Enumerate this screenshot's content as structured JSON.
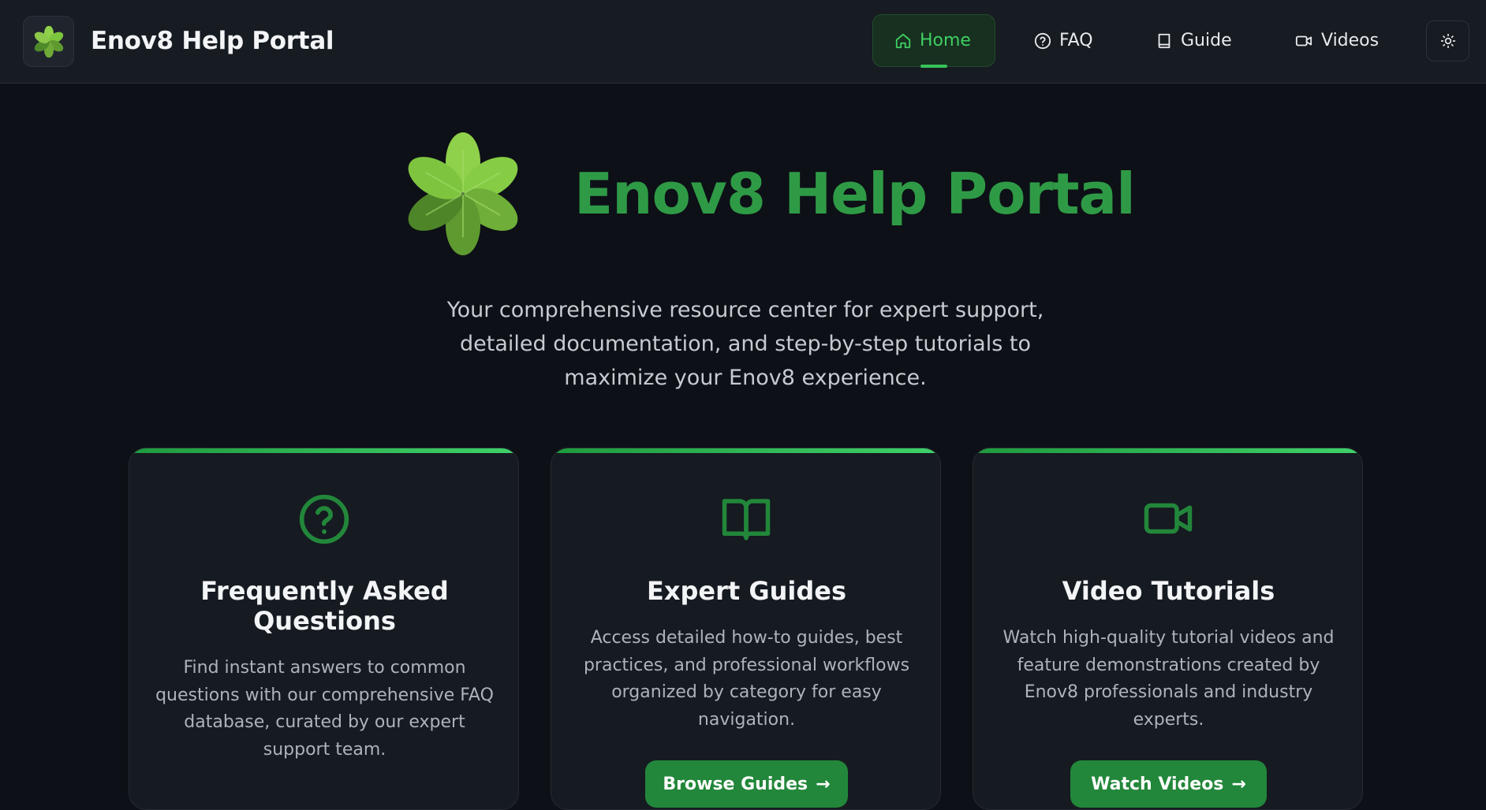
{
  "colors": {
    "accent": "#2f9a46",
    "accent_bright": "#3ecf63",
    "background": "#0d1016",
    "header_bg": "#171b22",
    "card_bg": "#161a21"
  },
  "header": {
    "brand": "Enov8 Help Portal",
    "logo_icon": "clover-icon",
    "nav": [
      {
        "label": "Home",
        "icon": "home-icon",
        "active": true
      },
      {
        "label": "FAQ",
        "icon": "question-circle-icon",
        "active": false
      },
      {
        "label": "Guide",
        "icon": "book-icon",
        "active": false
      },
      {
        "label": "Videos",
        "icon": "video-camera-icon",
        "active": false
      }
    ],
    "theme_toggle_icon": "sun-icon"
  },
  "hero": {
    "title": "Enov8 Help Portal",
    "subtitle": "Your comprehensive resource center for expert support, detailed documentation, and step-by-step tutorials to maximize your Enov8 experience."
  },
  "cards": [
    {
      "icon": "question-circle-icon",
      "title": "Frequently Asked Questions",
      "description": "Find instant answers to common questions with our comprehensive FAQ database, curated by our expert support team.",
      "button": ""
    },
    {
      "icon": "open-book-icon",
      "title": "Expert Guides",
      "description": "Access detailed how-to guides, best practices, and professional workflows organized by category for easy navigation.",
      "button": "Browse Guides"
    },
    {
      "icon": "video-camera-icon",
      "title": "Video Tutorials",
      "description": "Watch high-quality tutorial videos and feature demonstrations created by Enov8 professionals and industry experts.",
      "button": "Watch Videos"
    }
  ]
}
